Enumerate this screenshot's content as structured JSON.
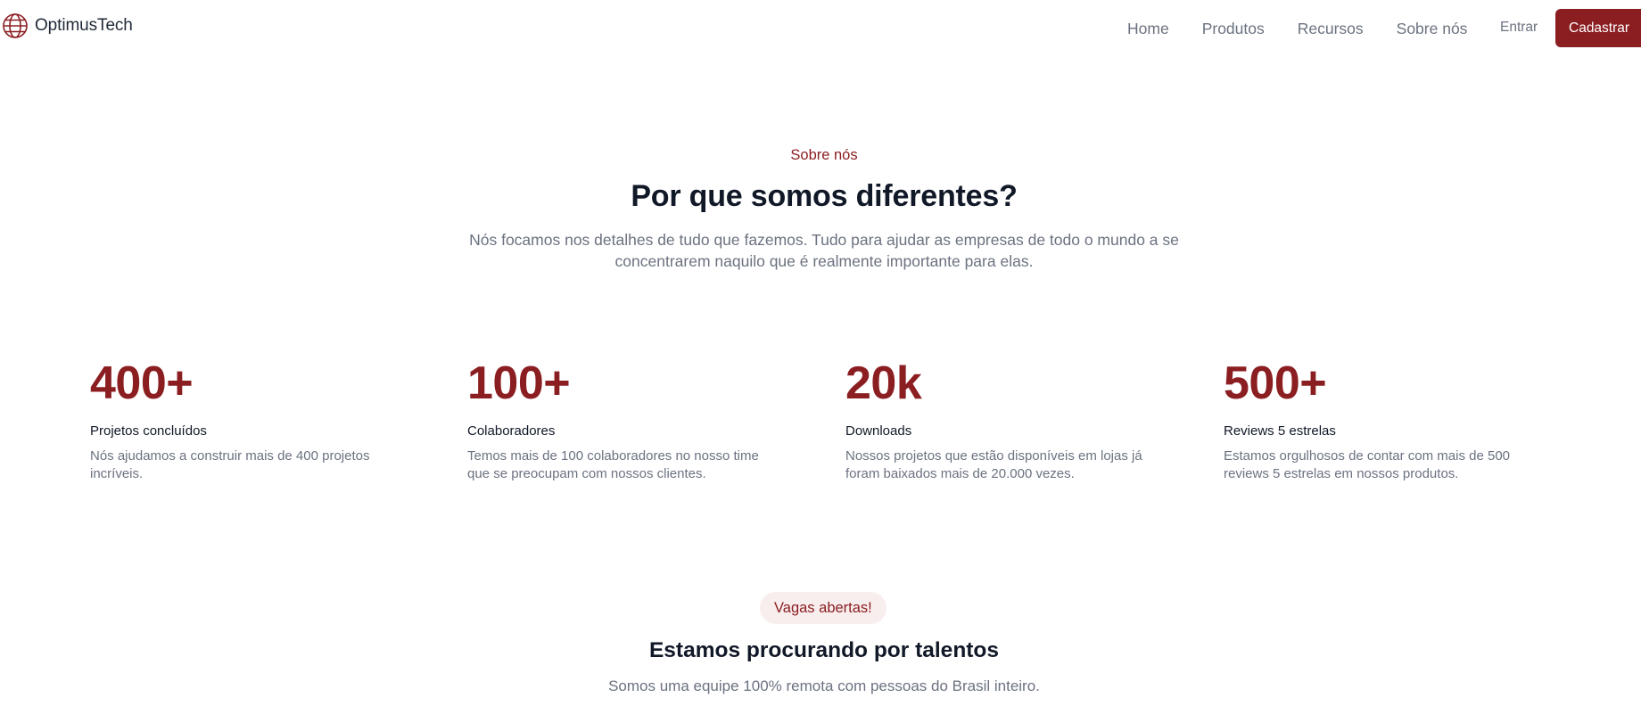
{
  "brand": {
    "name": "OptimusTech",
    "icon": "globe-icon",
    "accent_color": "#8b1e21"
  },
  "nav": {
    "items": [
      {
        "label": "Home"
      },
      {
        "label": "Produtos"
      },
      {
        "label": "Recursos"
      },
      {
        "label": "Sobre nós"
      }
    ],
    "login_label": "Entrar",
    "signup_label": "Cadastrar"
  },
  "about": {
    "eyebrow": "Sobre nós",
    "title": "Por que somos diferentes?",
    "description": "Nós focamos nos detalhes de tudo que fazemos. Tudo para ajudar as empresas de todo o mundo a se concentrarem naquilo que é realmente importante para elas."
  },
  "stats": [
    {
      "value": "400+",
      "label": "Projetos concluídos",
      "description": "Nós ajudamos a construir mais de 400 projetos incríveis."
    },
    {
      "value": "100+",
      "label": "Colaboradores",
      "description": "Temos mais de 100 colaboradores no nosso time que se preocupam com nossos clientes."
    },
    {
      "value": "20k",
      "label": "Downloads",
      "description": "Nossos projetos que estão disponíveis em lojas já foram baixados mais de 20.000 vezes."
    },
    {
      "value": "500+",
      "label": "Reviews 5 estrelas",
      "description": "Estamos orgulhosos de contar com mais de 500 reviews 5 estrelas em nossos produtos."
    }
  ],
  "jobs": {
    "badge": "Vagas abertas!",
    "title": "Estamos procurando por talentos",
    "description": "Somos uma equipe 100% remota com pessoas do Brasil inteiro."
  }
}
